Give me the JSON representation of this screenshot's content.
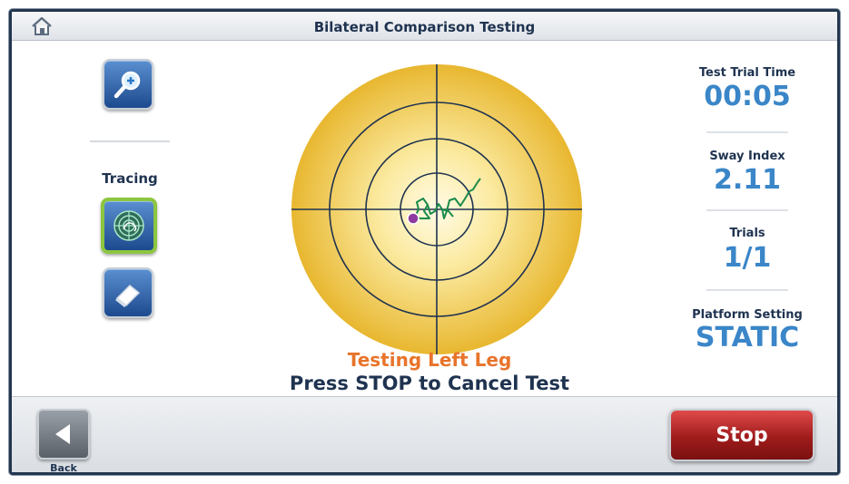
{
  "header": {
    "title": "Bilateral Comparison Testing",
    "home_icon": "home-icon"
  },
  "left_panel": {
    "zoom_icon": "magnifier-plus-icon",
    "tracing_label": "Tracing",
    "tracing_icon": "target-tracing-icon",
    "eraser_icon": "eraser-icon",
    "active_color": "#8cc63f"
  },
  "target": {
    "ring_count": 4,
    "outer_color": "#e8b730",
    "inner_color": "#fff8d8",
    "trace_color": "#1a8a4a",
    "marker_color": "#8e3aa0"
  },
  "status": {
    "line1": "Testing Left Leg",
    "line2": "Press STOP to Cancel Test",
    "line1_color": "#e8742b"
  },
  "stats": {
    "trial_time_label": "Test Trial Time",
    "trial_time_value": "00:05",
    "sway_index_label": "Sway Index",
    "sway_index_value": "2.11",
    "trials_label": "Trials",
    "trials_value": "1/1",
    "platform_label": "Platform Setting",
    "platform_value": "STATIC"
  },
  "footer": {
    "back_label": "Back",
    "stop_label": "Stop",
    "stop_color": "#a01c1c"
  }
}
